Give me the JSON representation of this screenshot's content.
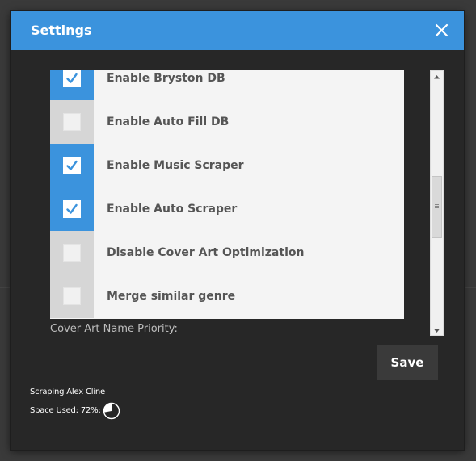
{
  "dialog": {
    "title": "Settings",
    "close_icon": "close-icon"
  },
  "settings": [
    {
      "label": "Enable Bryston DB",
      "checked": true
    },
    {
      "label": "Enable Auto Fill DB",
      "checked": false
    },
    {
      "label": "Enable Music Scraper",
      "checked": true
    },
    {
      "label": "Enable Auto Scraper",
      "checked": true
    },
    {
      "label": "Disable Cover Art Optimization",
      "checked": false
    },
    {
      "label": "Merge similar genre",
      "checked": false
    }
  ],
  "cover_art": {
    "label": "Cover Art Name Priority:"
  },
  "actions": {
    "save_label": "Save"
  },
  "status": {
    "scraping_text": "Scraping Alex Cline",
    "space_used_label": "Space Used: 72%:",
    "space_used_fraction": 0.72
  },
  "colors": {
    "accent": "#3b93dd",
    "dialog_bg": "#272727",
    "list_bg": "#f4f4f4",
    "label_text": "#555555"
  }
}
